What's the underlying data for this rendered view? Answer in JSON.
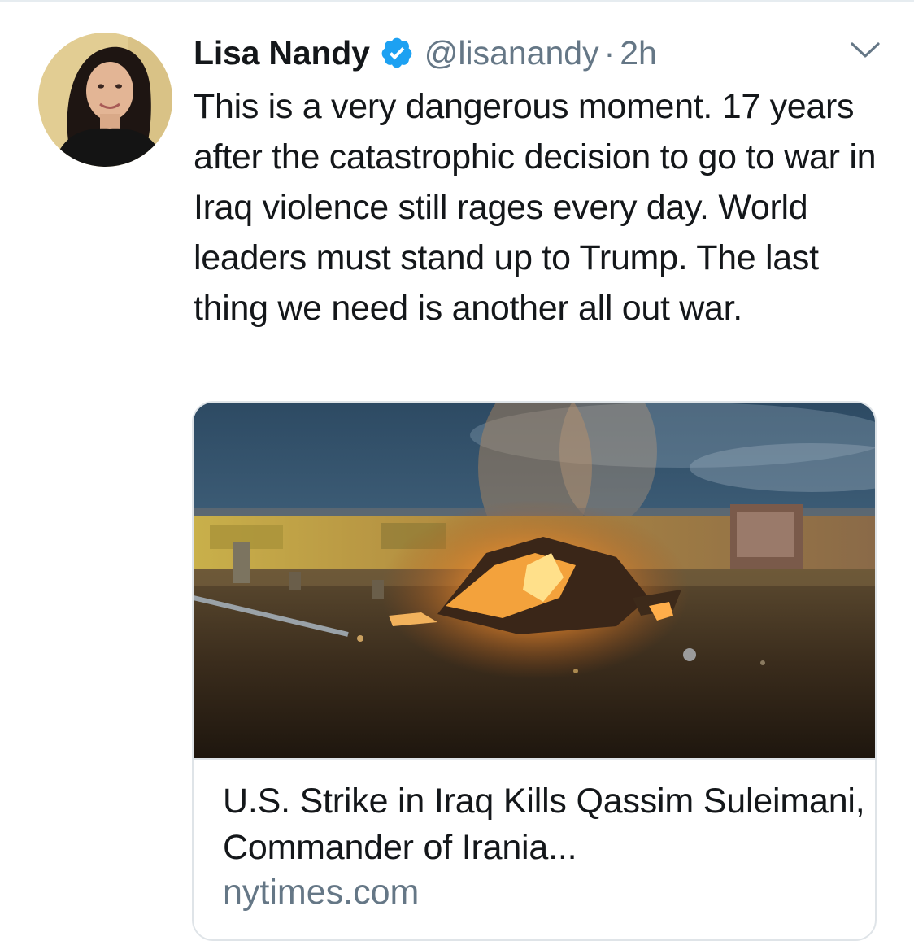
{
  "colors": {
    "text_primary": "#14171a",
    "text_secondary": "#657786",
    "verified_blue": "#1da1f2",
    "border": "#dfe4e8"
  },
  "tweet": {
    "author": {
      "display_name": "Lisa Nandy",
      "handle": "@lisanandy",
      "verified_icon": "verified-badge-icon",
      "avatar_icon": "avatar-photo"
    },
    "separator": "·",
    "time": "2h",
    "menu_icon": "chevron-down-icon",
    "text": "This is a very dangerous moment. 17 years after the catastrophic decision to go to war in Iraq violence still rages every day. World leaders must stand up to Trump. The last thing we need is another all out war.",
    "card": {
      "image_icon": "burning-vehicle-photo",
      "title": "U.S. Strike in Iraq Kills Qassim Suleimani, Commander of Irania...",
      "domain": "nytimes.com"
    }
  }
}
